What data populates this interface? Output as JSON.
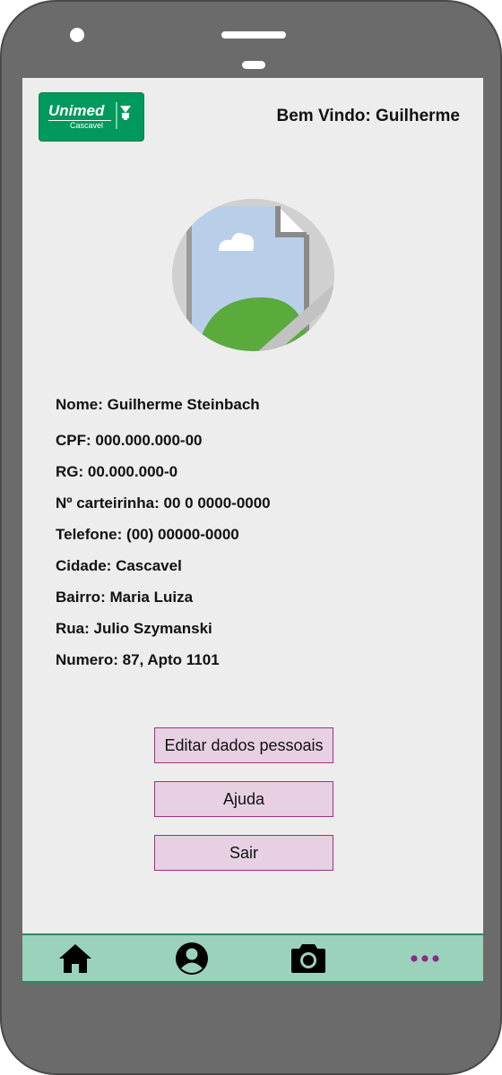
{
  "header": {
    "logo": {
      "brand": "Unimed",
      "city": "Cascavel"
    },
    "welcome_prefix": "Bem Vindo: ",
    "welcome_name": "Guilherme"
  },
  "profile": {
    "avatar_icon": "image-placeholder-icon",
    "fields": [
      {
        "label": "Nome: ",
        "value": "Guilherme Steinbach"
      },
      {
        "label": "CPF: ",
        "value": "000.000.000-00"
      },
      {
        "label": "RG: ",
        "value": "00.000.000-0"
      },
      {
        "label": "Nº carteirinha: ",
        "value": "00 0 0000-0000"
      },
      {
        "label": "Telefone: ",
        "value": "(00) 00000-0000"
      },
      {
        "label": "Cidade: ",
        "value": "Cascavel"
      },
      {
        "label": "Bairro: ",
        "value": "Maria Luiza"
      },
      {
        "label": "Rua: ",
        "value": "Julio Szymanski"
      },
      {
        "label": "Numero: ",
        "value": "87, Apto 1101"
      }
    ]
  },
  "actions": {
    "edit_label": "Editar dados pessoais",
    "help_label": "Ajuda",
    "logout_label": "Sair"
  },
  "bottom_nav": {
    "items": [
      "home-icon",
      "user-profile-icon",
      "camera-icon",
      "more-dots-icon"
    ],
    "active_color": "#8e2a86"
  },
  "colors": {
    "brand_green": "#00995d",
    "nav_background": "#9bd2bb",
    "button_background": "#e6d0e2",
    "button_border": "#a2307f"
  }
}
